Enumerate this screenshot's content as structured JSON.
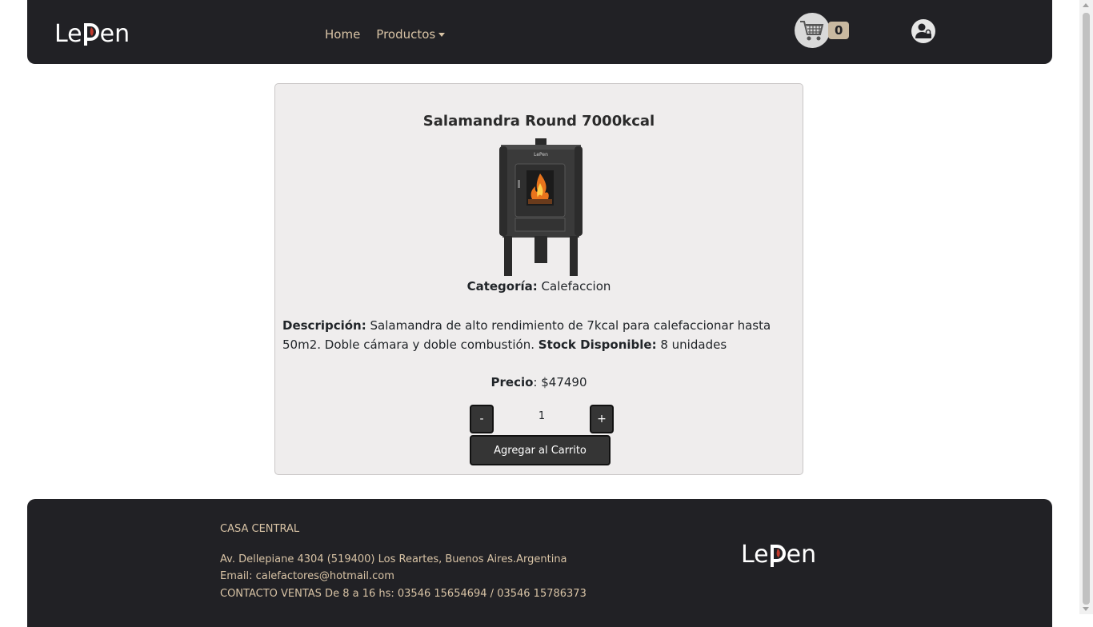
{
  "brand": {
    "name": "LePen",
    "name_left": "Le",
    "name_p": "P",
    "name_right": "en",
    "flame_color": "#c0392b"
  },
  "nav": {
    "home_label": "Home",
    "products_label": "Productos",
    "cart_count": "0"
  },
  "product": {
    "title": "Salamandra Round 7000kcal",
    "category_label": "Categoría:",
    "category_value": "Calefaccion",
    "description_label": "Descripción:",
    "description_value": "Salamandra de alto rendimiento de 7kcal para calefaccionar hasta 50m2. Doble cámara y doble combustión.",
    "stock_label": "Stock Disponible:",
    "stock_value": "8 unidades",
    "price_label": "Precio",
    "price_value": ": $47490",
    "quantity": "1",
    "minus_label": "-",
    "plus_label": "+",
    "add_to_cart_label": "Agregar al Carrito",
    "stove_logo": "LePen"
  },
  "footer": {
    "heading": "CASA CENTRAL",
    "address": "Av. Dellepiane 4304 (519400) Los Reartes, Buenos Aires.Argentina",
    "email": "Email: calefactores@hotmail.com",
    "contact": "CONTACTO VENTAS De 8 a 16 hs: 03546 15654694 / 03546 15786373"
  },
  "colors": {
    "navbar_bg": "#212125",
    "nav_link": "#d8c3a5",
    "card_bg": "#efeded",
    "button_bg": "#353535",
    "badge_bg": "#c9b9a1"
  }
}
